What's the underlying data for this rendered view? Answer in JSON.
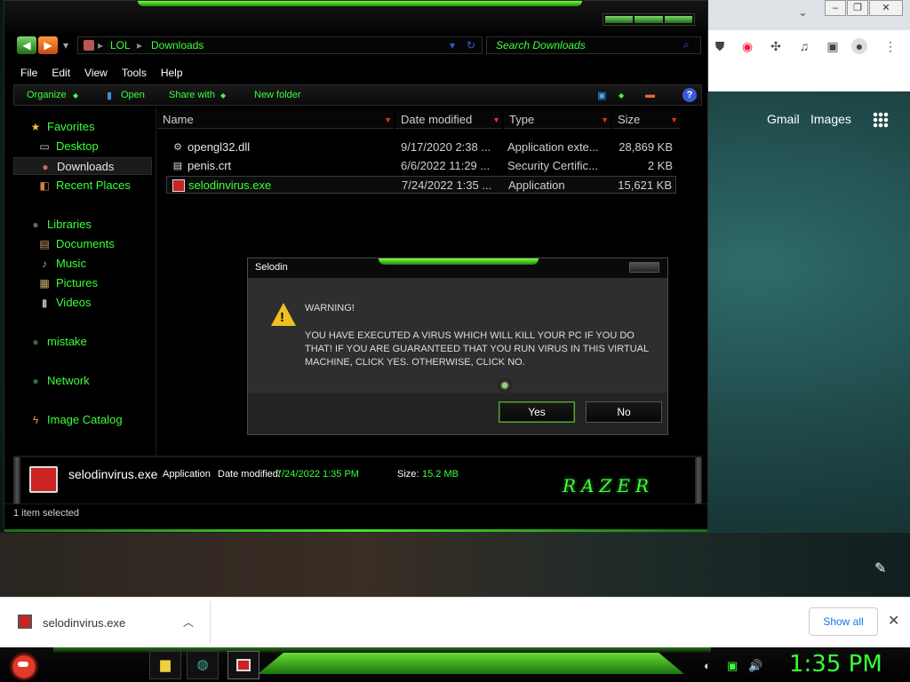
{
  "explorer": {
    "address": {
      "segment1": "LOL",
      "segment2": "Downloads"
    },
    "search_placeholder": "Search Downloads",
    "menu": [
      "File",
      "Edit",
      "View",
      "Tools",
      "Help"
    ],
    "toolbar": {
      "organize": "Organize",
      "open": "Open",
      "share_with": "Share with",
      "new_folder": "New folder"
    },
    "nav": {
      "favorites": "Favorites",
      "desktop": "Desktop",
      "downloads": "Downloads",
      "recent_places": "Recent Places",
      "libraries": "Libraries",
      "documents": "Documents",
      "music": "Music",
      "pictures": "Pictures",
      "videos": "Videos",
      "mistake": "mistake",
      "network": "Network",
      "image_catalog": "Image Catalog"
    },
    "columns": {
      "name": "Name",
      "date_modified": "Date modified",
      "type": "Type",
      "size": "Size"
    },
    "files": [
      {
        "name": "opengl32.dll",
        "date": "9/17/2020 2:38 ...",
        "type": "Application exte...",
        "size": "28,869 KB"
      },
      {
        "name": "penis.crt",
        "date": "6/6/2022 11:29 ...",
        "type": "Security Certific...",
        "size": "2 KB"
      },
      {
        "name": "selodinvirus.exe",
        "date": "7/24/2022 1:35 ...",
        "type": "Application",
        "size": "15,621 KB"
      }
    ],
    "details": {
      "filename": "selodinvirus.exe",
      "type": "Application",
      "date_label": "Date modified:",
      "date_value": "7/24/2022 1:35 PM",
      "size_label": "Size:",
      "size_value": "15.2 MB",
      "brand": "RAZER"
    },
    "status": "1 item selected"
  },
  "dialog": {
    "title": "Selodin",
    "heading": "WARNING!",
    "message": "YOU HAVE EXECUTED A VIRUS WHICH WILL KILL YOUR PC IF YOU DO THAT! IF YOU ARE GUARANTEED THAT YOU RUN VIRUS IN THIS VIRTUAL MACHINE, CLICK YES. OTHERWISE, CLICK NO.",
    "yes": "Yes",
    "no": "No"
  },
  "browser": {
    "gmail": "Gmail",
    "images": "Images"
  },
  "download_bar": {
    "filename": "selodinvirus.exe",
    "show_all": "Show all"
  },
  "taskbar": {
    "clock": "1:35 PM"
  },
  "colors": {
    "accent_green": "#3bff3b",
    "warning_yellow": "#f0c020",
    "chrome_blue": "#1a73e8"
  }
}
